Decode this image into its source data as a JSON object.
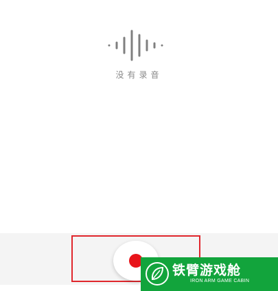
{
  "empty_state": {
    "icon": "audio-waveform-icon",
    "label": "没有录音"
  },
  "recorder": {
    "record_icon": "record-dot-icon",
    "record_color": "#e8141a",
    "highlight_color": "#e0262c"
  },
  "watermark": {
    "title": "铁臂游戏舱",
    "subtitle": "IRON ARM GAME CABIN",
    "color": "#12a43c"
  }
}
